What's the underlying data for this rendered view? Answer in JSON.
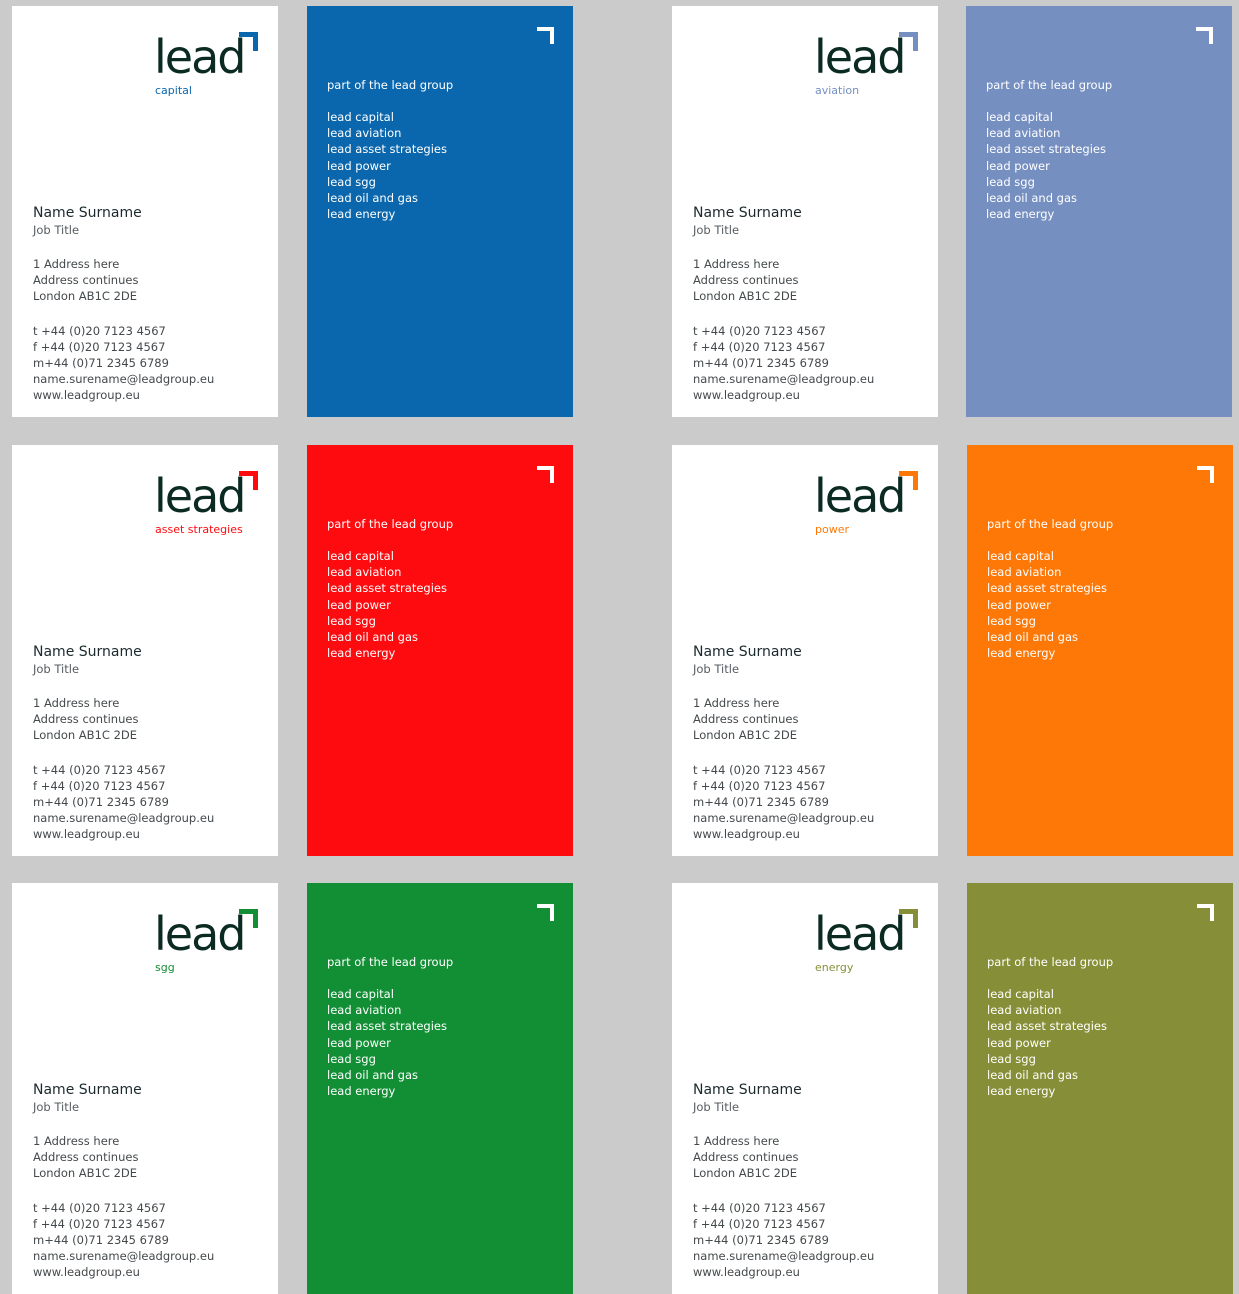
{
  "logo_word": "lead",
  "person": {
    "name": "Name Surname",
    "job": "Job Title",
    "address": [
      "1 Address here",
      "Address continues",
      "London AB1C 2DE"
    ],
    "contact": [
      "t  +44 (0)20 7123 4567",
      "f  +44 (0)20 7123 4567",
      "m+44 (0)71 2345 6789",
      "name.surename@leadgroup.eu",
      "www.leadgroup.eu"
    ]
  },
  "back": {
    "title": "part of the lead group",
    "brands": [
      "lead capital",
      "lead aviation",
      "lead asset strategies",
      "lead power",
      "lead sgg",
      "lead oil and gas",
      "lead energy"
    ]
  },
  "cards": [
    {
      "sub": "capital",
      "color": "#0b67ad"
    },
    {
      "sub": "aviation",
      "color": "#768fc1"
    },
    {
      "sub": "asset strategies",
      "color": "#fe0b10"
    },
    {
      "sub": "power",
      "color": "#fe7808"
    },
    {
      "sub": "sgg",
      "color": "#128f35"
    },
    {
      "sub": "energy",
      "color": "#868f37"
    }
  ]
}
